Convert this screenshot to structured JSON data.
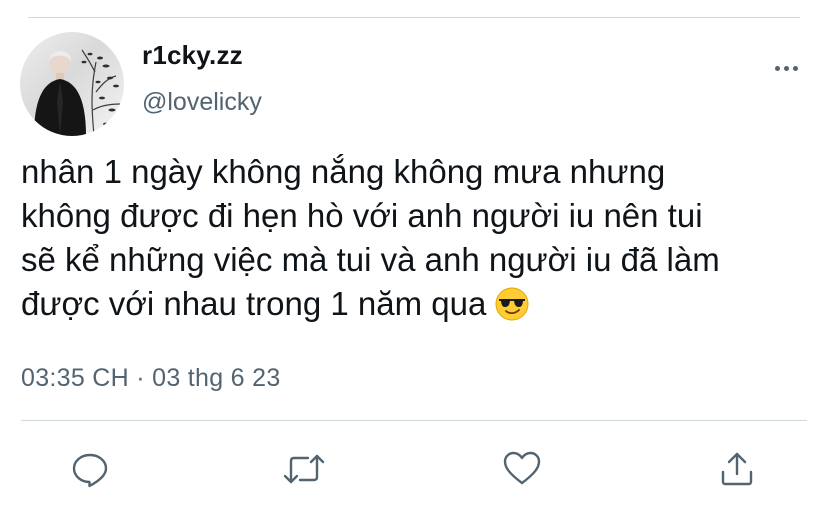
{
  "tweet": {
    "author": {
      "display_name": "r1cky.zz",
      "handle": "@lovelicky",
      "avatar_icon": "profile-photo"
    },
    "text_lines": [
      "nhân 1 ngày không nắng không mưa nhưng",
      "không được đi hẹn hò với anh người iu nên tui",
      "sẽ kể những việc mà tui và anh người iu đã làm",
      "được với nhau trong 1 năm qua"
    ],
    "emoji": "smiling-face-with-sunglasses",
    "timestamp": "03:35 CH · 03 thg 6 23"
  },
  "actions": [
    {
      "icon": "reply-icon"
    },
    {
      "icon": "retweet-icon"
    },
    {
      "icon": "like-icon"
    },
    {
      "icon": "share-icon"
    }
  ],
  "colors": {
    "text": "#0f1419",
    "secondary": "#536471",
    "divider": "#cfd9de",
    "background": "#ffffff"
  }
}
